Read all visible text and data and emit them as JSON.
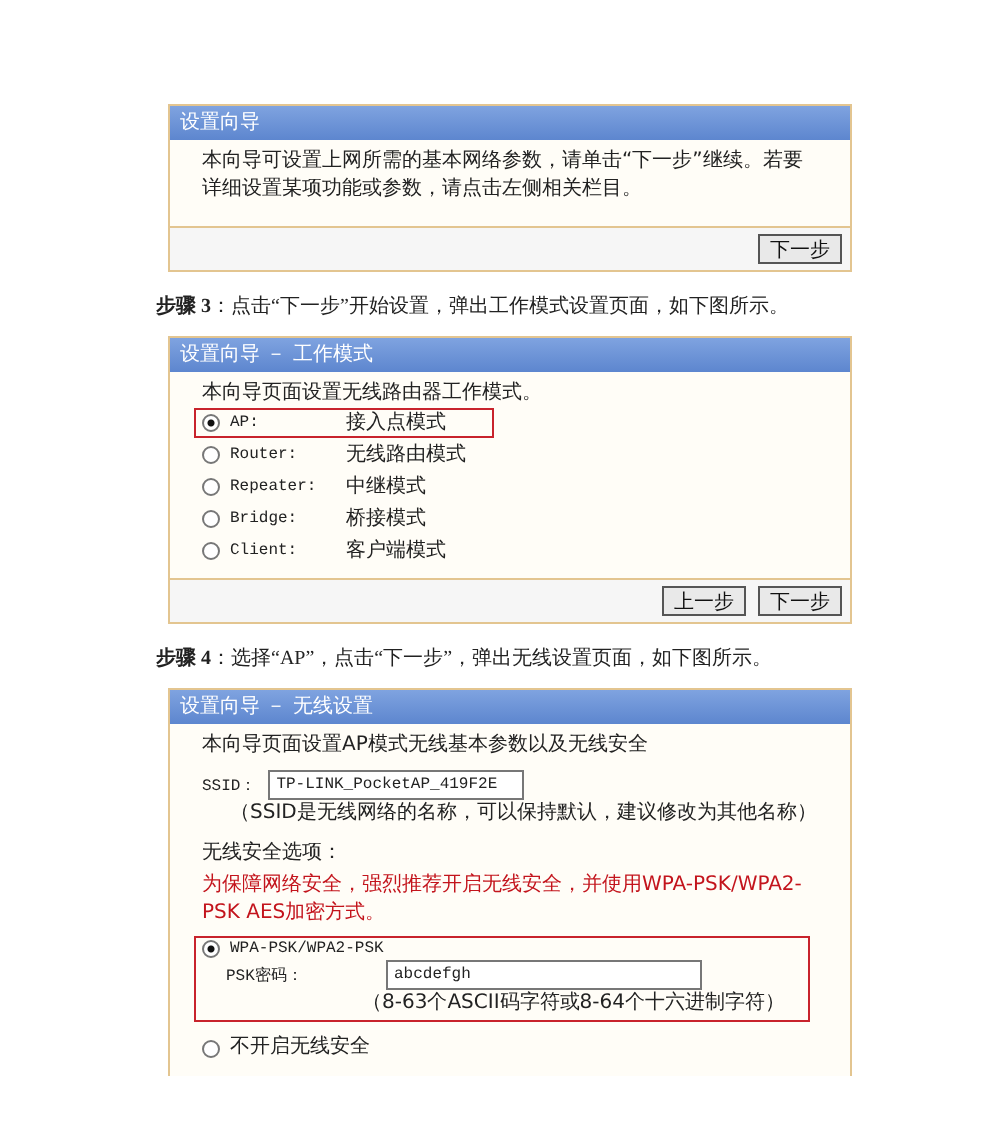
{
  "intro_panel": {
    "title": "设置向导",
    "text": "本向导可设置上网所需的基本网络参数，请单击“下一步”继续。若要详细设置某项功能或参数，请点击左侧相关栏目。",
    "buttons": [
      "下一步"
    ]
  },
  "step3": "**步骤 3**：点击“下一步”开始设置，弹出工作模式设置页面，如下图所示。",
  "work_mode_panel": {
    "title": "设置向导 － 工作模式",
    "intro": "本向导页面设置无线路由器工作模式。",
    "options": [
      {
        "label": "AP:",
        "description": "接入点模式",
        "selected": true,
        "highlighted": true
      },
      {
        "label": "Router:",
        "description": "无线路由模式",
        "selected": false,
        "highlighted": false
      },
      {
        "label": "Repeater:",
        "description": "中继模式",
        "selected": false,
        "highlighted": false
      },
      {
        "label": "Bridge:",
        "description": "桥接模式",
        "selected": false,
        "highlighted": false
      },
      {
        "label": "Client:",
        "description": "客户端模式",
        "selected": false,
        "highlighted": false
      }
    ],
    "buttons": [
      "上一步",
      "下一步"
    ]
  },
  "step4": "**步骤 4**：选择“AP”，点击“下一步”，弹出无线设置页面，如下图所示。",
  "wireless_panel": {
    "title": "设置向导 － 无线设置",
    "intro": "本向导页面设置AP模式无线基本参数以及无线安全",
    "ssid_label": "SSID：",
    "ssid_value": "TP-LINK_PocketAP_419F2E",
    "ssid_hint": "（SSID是无线网络的名称，可以保持默认，建议修改为其他名称）",
    "security_heading": "无线安全选项：",
    "security_warning": "为保障网络安全，强烈推荐开启无线安全，并使用WPA-PSK/WPA2-PSK AES加密方式。",
    "options": [
      {
        "label": "WPA-PSK/WPA2-PSK",
        "selected": true,
        "highlighted": true,
        "password_label": "PSK密码：",
        "password_value": "abcdefgh",
        "password_hint": "（8-63个ASCII码字符或8-64个十六进制字符）"
      },
      {
        "label": "不开启无线安全",
        "selected": false,
        "highlighted": false
      }
    ]
  }
}
